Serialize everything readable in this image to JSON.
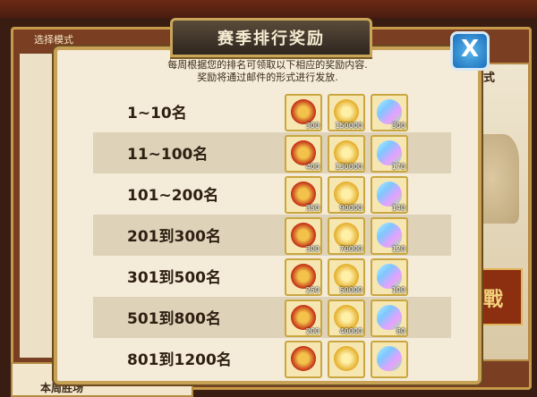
{
  "background": {
    "select_mode_label": "选择模式",
    "mode_label": "模式",
    "weekly_label": "本周胜场",
    "battle_button": "戰"
  },
  "dialog": {
    "title": "赛季排行奖励",
    "close_label": "X",
    "description_line1": "每周根据您的排名可领取以下相应的奖励内容.",
    "description_line2": "奖励将通过邮件的形式进行发放.",
    "rows": [
      {
        "rank": "1~10名",
        "rewards": [
          "300",
          "150000",
          "300"
        ]
      },
      {
        "rank": "11~100名",
        "rewards": [
          "400",
          "130000",
          "170"
        ]
      },
      {
        "rank": "101~200名",
        "rewards": [
          "350",
          "90000",
          "140"
        ]
      },
      {
        "rank": "201到300名",
        "rewards": [
          "300",
          "70000",
          "120"
        ]
      },
      {
        "rank": "301到500名",
        "rewards": [
          "250",
          "50000",
          "100"
        ]
      },
      {
        "rank": "501到800名",
        "rewards": [
          "200",
          "40000",
          "80"
        ]
      },
      {
        "rank": "801到1200名",
        "rewards": [
          "",
          "",
          ""
        ]
      }
    ]
  }
}
